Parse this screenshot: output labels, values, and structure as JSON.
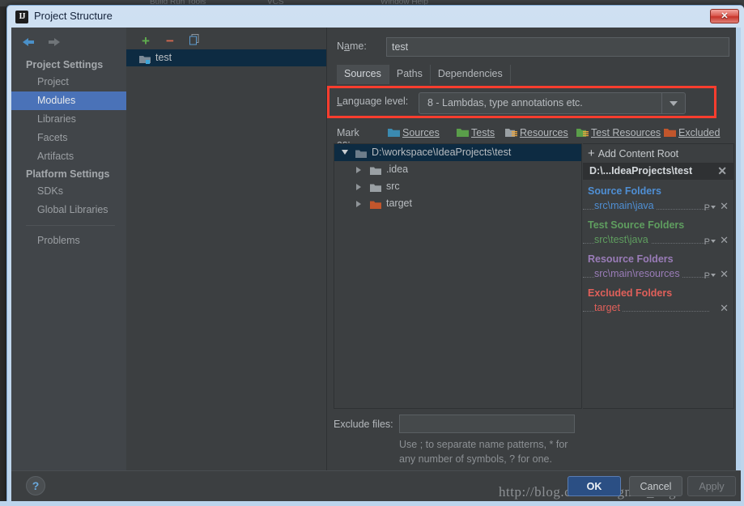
{
  "window": {
    "title": "Project Structure",
    "app_icon": "intellij-idea-icon",
    "close_label": "✕"
  },
  "nav": {
    "back_icon": "arrow-left-icon",
    "forward_icon": "arrow-right-icon",
    "items": [
      {
        "label": "Project Settings",
        "type": "group"
      },
      {
        "label": "Project",
        "type": "item",
        "selected": false
      },
      {
        "label": "Modules",
        "type": "item",
        "selected": true
      },
      {
        "label": "Libraries",
        "type": "item",
        "selected": false
      },
      {
        "label": "Facets",
        "type": "item",
        "selected": false
      },
      {
        "label": "Artifacts",
        "type": "item",
        "selected": false
      },
      {
        "label": "Platform Settings",
        "type": "group"
      },
      {
        "label": "SDKs",
        "type": "item",
        "selected": false
      },
      {
        "label": "Global Libraries",
        "type": "item",
        "selected": false
      },
      {
        "label": "",
        "type": "separator"
      },
      {
        "label": "Problems",
        "type": "item",
        "selected": false
      }
    ]
  },
  "modules": {
    "toolbar": {
      "add_label": "+",
      "remove_label": "−",
      "copy_icon": "copy-icon"
    },
    "rows": [
      {
        "label": "test",
        "selected": true
      }
    ]
  },
  "editor": {
    "name_label": "Name:",
    "name_value": "test",
    "name_placeholder": "",
    "tabs": [
      {
        "label": "Sources",
        "active": true
      },
      {
        "label": "Paths",
        "active": false
      },
      {
        "label": "Dependencies",
        "active": false
      }
    ],
    "language_level": {
      "label": "Language level:",
      "value": "8 - Lambdas, type annotations etc.",
      "arrow_icon": "chevron-down-icon",
      "highlight_color": "#fc3d2e"
    },
    "mark_as": {
      "label": "Mark as:",
      "options": [
        {
          "label": "Sources",
          "color": "#3b8ab0",
          "icon": "folder-sources-icon"
        },
        {
          "label": "Tests",
          "color": "#5a9e4a",
          "icon": "folder-tests-icon"
        },
        {
          "label": "Resources",
          "color": "#9aa0a4",
          "icon": "folder-resources-icon"
        },
        {
          "label": "Test Resources",
          "color": "#5a9e4a",
          "icon": "folder-test-resources-icon"
        },
        {
          "label": "Excluded",
          "color": "#c2562c",
          "icon": "folder-excluded-icon"
        }
      ]
    },
    "tree": [
      {
        "label": "D:\\workspace\\IdeaProjects\\test",
        "depth": 0,
        "expanded": true,
        "selected": true,
        "color": "#b9bdc1",
        "folder_color": "#6d7d8b"
      },
      {
        "label": ".idea",
        "depth": 1,
        "expanded": false,
        "selected": false,
        "color": "#b9bdc1",
        "folder_color": "#9aa0a4"
      },
      {
        "label": "src",
        "depth": 1,
        "expanded": false,
        "selected": false,
        "color": "#b9bdc1",
        "folder_color": "#9aa0a4"
      },
      {
        "label": "target",
        "depth": 1,
        "expanded": false,
        "selected": false,
        "color": "#b9bdc1",
        "folder_color": "#c2562c"
      }
    ],
    "exclude_files": {
      "label": "Exclude files:",
      "value": "",
      "placeholder": "",
      "help": "Use ; to separate name patterns, * for any number of symbols, ? for one."
    }
  },
  "content_roots": {
    "add_label": "Add Content Root",
    "add_icon": "plus-icon",
    "header": "D:\\...IdeaProjects\\test",
    "header_close_icon": "close-icon",
    "groups": [
      {
        "title": "Source Folders",
        "color": "#4f8fd4",
        "rows": [
          {
            "path": "src\\main\\java",
            "color": "#4f8fd4",
            "has_prefix": true,
            "prefix_label": "P"
          }
        ]
      },
      {
        "title": "Test Source Folders",
        "color": "#5f9e5f",
        "rows": [
          {
            "path": "src\\test\\java",
            "color": "#5f9e5f",
            "has_prefix": true,
            "prefix_label": "P"
          }
        ]
      },
      {
        "title": "Resource Folders",
        "color": "#9a7cb8",
        "rows": [
          {
            "path": "src\\main\\resources",
            "color": "#9a7cb8",
            "has_prefix": true,
            "prefix_label": "P"
          }
        ]
      },
      {
        "title": "Excluded Folders",
        "color": "#e0605a",
        "rows": [
          {
            "path": "target",
            "color": "#e0605a",
            "has_prefix": false,
            "prefix_label": ""
          }
        ]
      }
    ]
  },
  "footer": {
    "help_label": "?",
    "ok_label": "OK",
    "cancel_label": "Cancel",
    "apply_label": "Apply",
    "watermark": "http://blog.csdn.net/gnail_oug"
  },
  "backdrop": {
    "ghost_left": "Build   Run   Tools",
    "ghost_mid": "VCS",
    "ghost_right": "Window   Help"
  }
}
